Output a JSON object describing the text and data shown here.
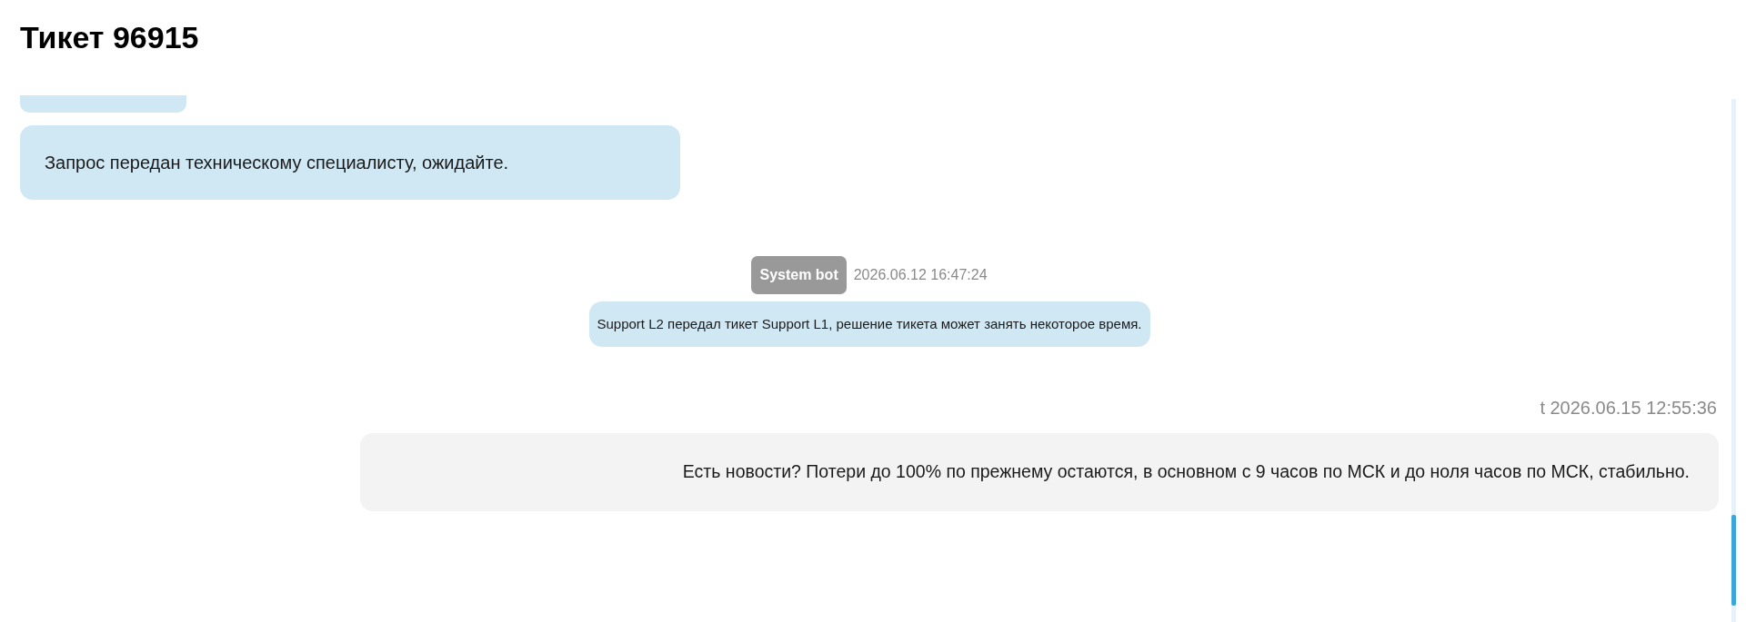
{
  "title": "Тикет 96915",
  "messages": [
    {
      "kind": "agent",
      "text": "Запрос передан техническому специалисту, ожидайте."
    },
    {
      "kind": "system",
      "author": "System bot",
      "time": "2026.06.12 16:47:24",
      "text": "Support L2 передал тикет Support L1, решение тикета может занять некоторое время."
    },
    {
      "kind": "user",
      "author": "t",
      "time": "2026.06.15 12:55:36",
      "text": "Есть новости? Потери до 100% по прежнему остаются, в основном с 9 часов по МСК и до ноля часов по МСК, стабильно."
    }
  ]
}
